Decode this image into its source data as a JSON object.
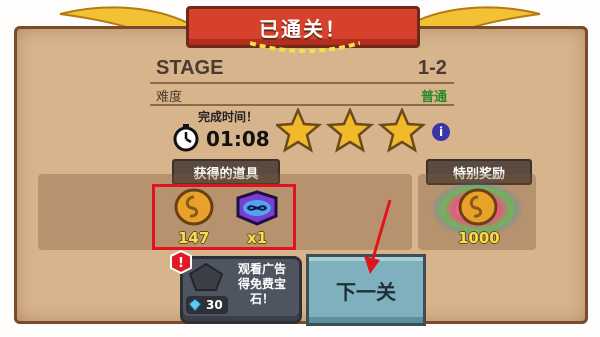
{
  "title": "已通关！",
  "stage": {
    "label": "STAGE",
    "value": "1-2"
  },
  "difficulty": {
    "label": "难度",
    "value": "普通"
  },
  "time": {
    "label": "完成时间！",
    "value": "01:08"
  },
  "stars": 3,
  "items_section": {
    "label": "获得的道具",
    "items": [
      {
        "icon": "gold-coin-icon",
        "count": "147"
      },
      {
        "icon": "blue-gem-icon",
        "count": "x1"
      }
    ]
  },
  "special_section": {
    "label": "特别奖励",
    "item": {
      "icon": "gold-coin-icon",
      "count": "1000"
    }
  },
  "ad_button": {
    "text": "观看广告得免费宝石！",
    "line1": "观看广告",
    "line2": "得免费宝",
    "line3": "石！",
    "cost": "30"
  },
  "next_button": {
    "label": "下一关"
  },
  "info_icon": "i",
  "colors": {
    "banner": "#d7402b",
    "parchment": "#d8b48c",
    "highlight": "#e0141e",
    "gold": "#f4e04a"
  }
}
